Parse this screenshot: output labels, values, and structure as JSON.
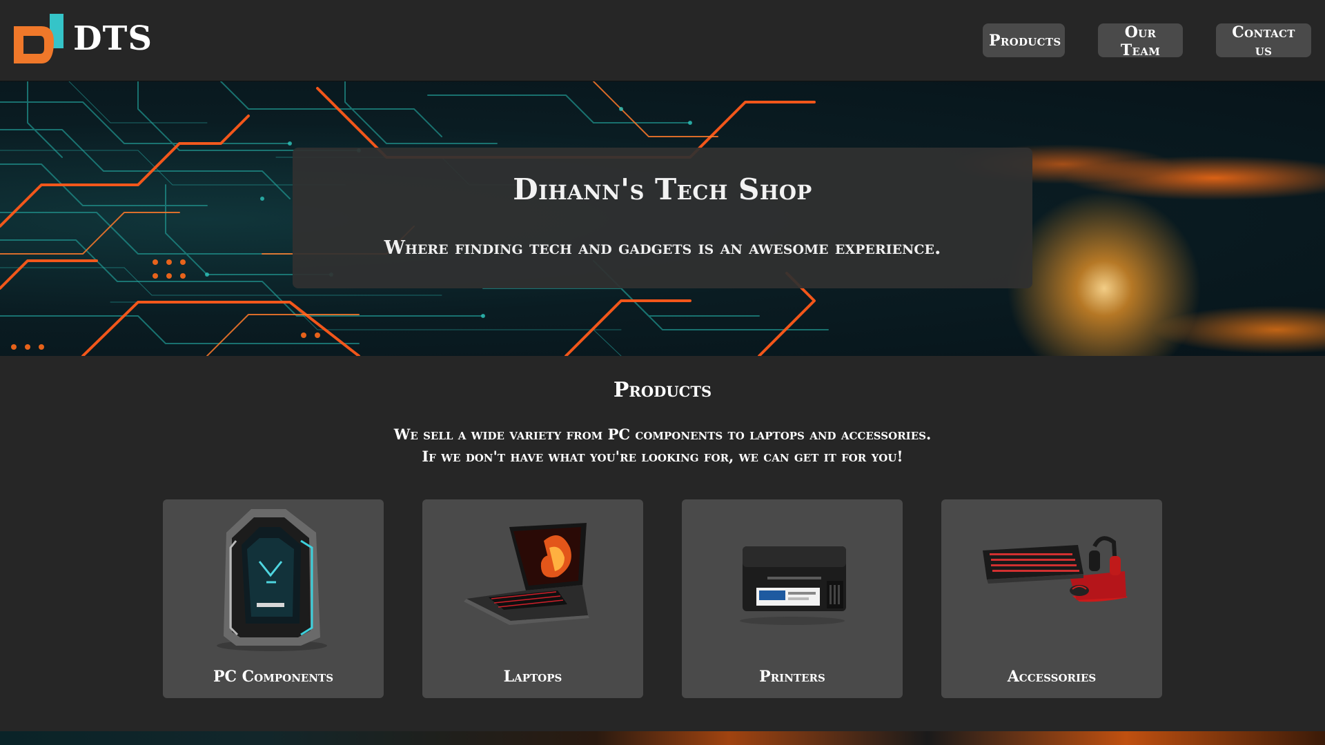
{
  "brand": {
    "name": "DTS",
    "logo_icon": "dts-logo-icon",
    "colors": {
      "orange": "#f0782a",
      "teal": "#35c4c8"
    }
  },
  "nav": {
    "items": [
      {
        "label": "Products"
      },
      {
        "label": "Our Team"
      },
      {
        "label": "Contact us"
      }
    ]
  },
  "hero": {
    "title": "Dihann's Tech Shop",
    "subtitle": "Where finding tech and gadgets is an awesome experience."
  },
  "products": {
    "heading": "Products",
    "description_lines": [
      "We sell a wide variety from PC components to laptops and accessories.",
      "If we don't have what you're looking for, we can get it for you!"
    ],
    "cards": [
      {
        "label": "PC Components",
        "icon": "pc-tower-icon"
      },
      {
        "label": "Laptops",
        "icon": "laptop-icon"
      },
      {
        "label": "Printers",
        "icon": "printer-icon"
      },
      {
        "label": "Accessories",
        "icon": "keyboard-headset-icon"
      }
    ]
  }
}
